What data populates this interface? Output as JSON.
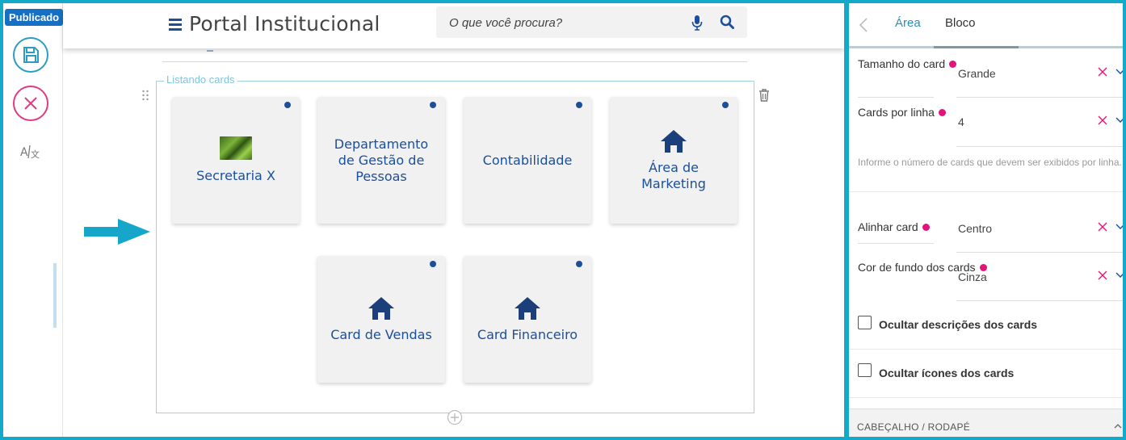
{
  "status_badge": "Publicado",
  "header": {
    "title": "Portal Institucional",
    "search_placeholder": "O que você procura?"
  },
  "section": {
    "legend": "Listando cards"
  },
  "cards": [
    {
      "label": "Secretaria X",
      "icon": "image-thumbnail"
    },
    {
      "label": "Departamento de Gestão de Pessoas",
      "icon": "none"
    },
    {
      "label": "Contabilidade",
      "icon": "none"
    },
    {
      "label": "Área de Marketing",
      "icon": "home-icon"
    },
    {
      "label": "Card de Vendas",
      "icon": "home-icon"
    },
    {
      "label": "Card Financeiro",
      "icon": "home-icon"
    }
  ],
  "panel": {
    "tabs": [
      "Área",
      "Bloco"
    ],
    "active_tab": "Bloco",
    "fields": [
      {
        "label": "Tamanho do card",
        "value": "Grande"
      },
      {
        "label": "Cards por linha",
        "value": "4"
      },
      {
        "label": "Alinhar card",
        "value": "Centro"
      },
      {
        "label": "Cor de fundo dos cards",
        "value": "Cinza"
      }
    ],
    "help_text": "Informe o número de cards que devem ser exibidos por linha.",
    "checkboxes": [
      {
        "label": "Ocultar descrições dos cards",
        "checked": false
      },
      {
        "label": "Ocultar ícones dos cards",
        "checked": false
      }
    ],
    "footer": "CABEÇALHO / RODAPÉ"
  },
  "colors": {
    "accent": "#13a9c8",
    "primary_blue": "#1b4f9c",
    "required": "#e2137a",
    "cancel": "#e03a83"
  }
}
